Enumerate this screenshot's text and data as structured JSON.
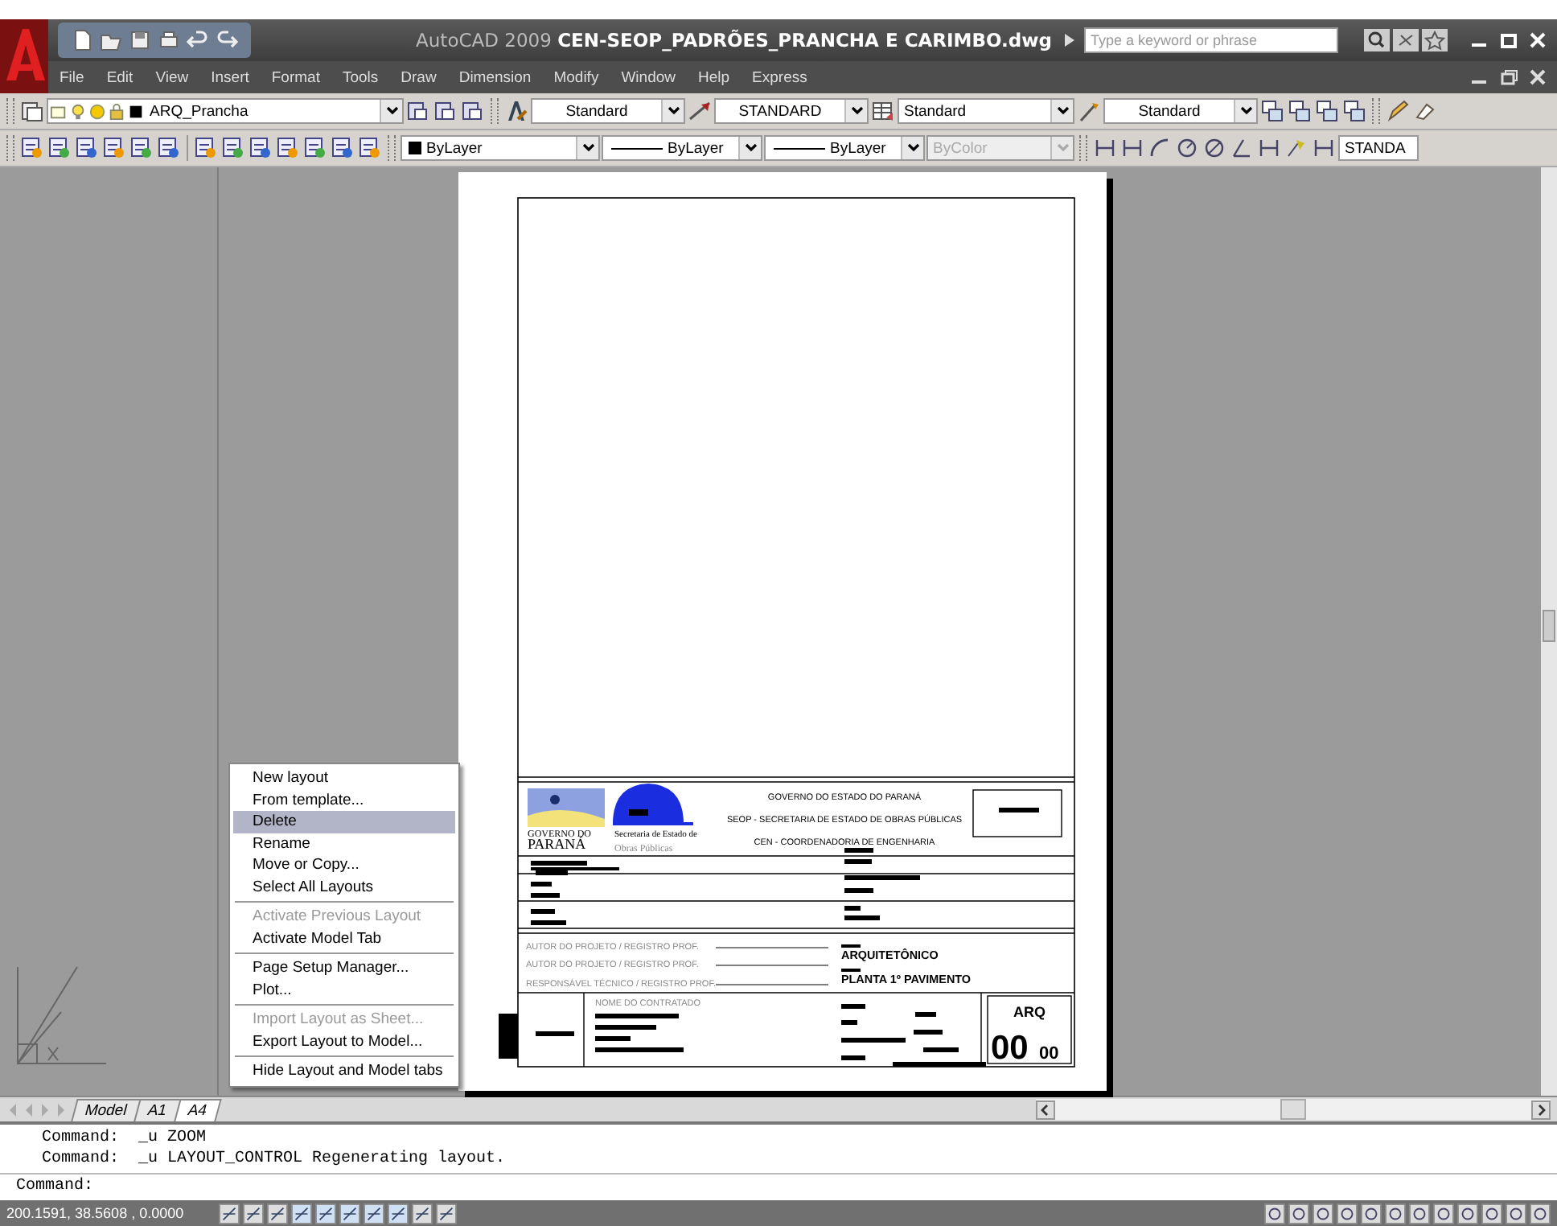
{
  "window": {
    "app": "AutoCAD 2009",
    "file": "CEN-SEOP_PADRÕES_PRANCHA E CARIMBO.dwg",
    "search_placeholder": "Type a keyword or phrase"
  },
  "menu": [
    "File",
    "Edit",
    "View",
    "Insert",
    "Format",
    "Tools",
    "Draw",
    "Dimension",
    "Modify",
    "Window",
    "Help",
    "Express"
  ],
  "toolbar": {
    "layer": "ARQ_Prancha",
    "text_style": "Standard",
    "dim_style": "STANDARD",
    "table_style": "Standard",
    "multileader_style": "Standard",
    "layer_color": "ByLayer",
    "linetype": "ByLayer",
    "lineweight": "ByLayer",
    "plot_style": "ByColor",
    "plot_style_disabled": true,
    "dim_style_2": "STANDA"
  },
  "title_block": {
    "header": [
      "GOVERNO DO ESTADO DO PARANÁ",
      "SEOP - SECRETARIA DE ESTADO DE OBRAS PÚBLICAS",
      "CEN - COORDENADORIA DE ENGENHARIA"
    ],
    "logo_line_1": "GOVERNO DO",
    "logo_line_2": "PARANÁ",
    "agency_small": "Secretaria de Estado de",
    "agency": "Obras Públicas",
    "signature_labels": [
      "AUTOR DO PROJETO / REGISTRO PROF.",
      "AUTOR DO PROJETO / REGISTRO PROF.",
      "RESPONSÁVEL TÉCNICO / REGISTRO PROF."
    ],
    "discipline": "ARQUITETÔNICO",
    "sheet_title": "PLANTA 1º PAVIMENTO",
    "contractor_label": "NOME DO CONTRATADO",
    "code": "ARQ",
    "sheet_number": "00",
    "revision": "00"
  },
  "context_menu": [
    {
      "label": "New layout",
      "selected": false,
      "disabled": false,
      "separator_after": false
    },
    {
      "label": "From template...",
      "selected": false,
      "disabled": false,
      "separator_after": false
    },
    {
      "label": "Delete",
      "selected": true,
      "disabled": false,
      "separator_after": false
    },
    {
      "label": "Rename",
      "selected": false,
      "disabled": false,
      "separator_after": false
    },
    {
      "label": "Move or Copy...",
      "selected": false,
      "disabled": false,
      "separator_after": false
    },
    {
      "label": "Select All Layouts",
      "selected": false,
      "disabled": false,
      "separator_after": true
    },
    {
      "label": "Activate Previous Layout",
      "selected": false,
      "disabled": true,
      "separator_after": false
    },
    {
      "label": "Activate Model Tab",
      "selected": false,
      "disabled": false,
      "separator_after": true
    },
    {
      "label": "Page Setup Manager...",
      "selected": false,
      "disabled": false,
      "separator_after": false
    },
    {
      "label": "Plot...",
      "selected": false,
      "disabled": false,
      "separator_after": true
    },
    {
      "label": "Import Layout as Sheet...",
      "selected": false,
      "disabled": true,
      "separator_after": false
    },
    {
      "label": "Export Layout to Model...",
      "selected": false,
      "disabled": false,
      "separator_after": true
    },
    {
      "label": "Hide Layout and Model tabs",
      "selected": false,
      "disabled": false,
      "separator_after": false
    }
  ],
  "layout_tabs": [
    {
      "label": "Model",
      "selected": false
    },
    {
      "label": "A1",
      "selected": false
    },
    {
      "label": "A4",
      "selected": true
    }
  ],
  "command_lines": [
    "Command:  _u ZOOM",
    "Command:  _u LAYOUT_CONTROL Regenerating layout."
  ],
  "command_prompt": "Command:",
  "coordinates": "200.1591, 38.5608 , 0.0000"
}
